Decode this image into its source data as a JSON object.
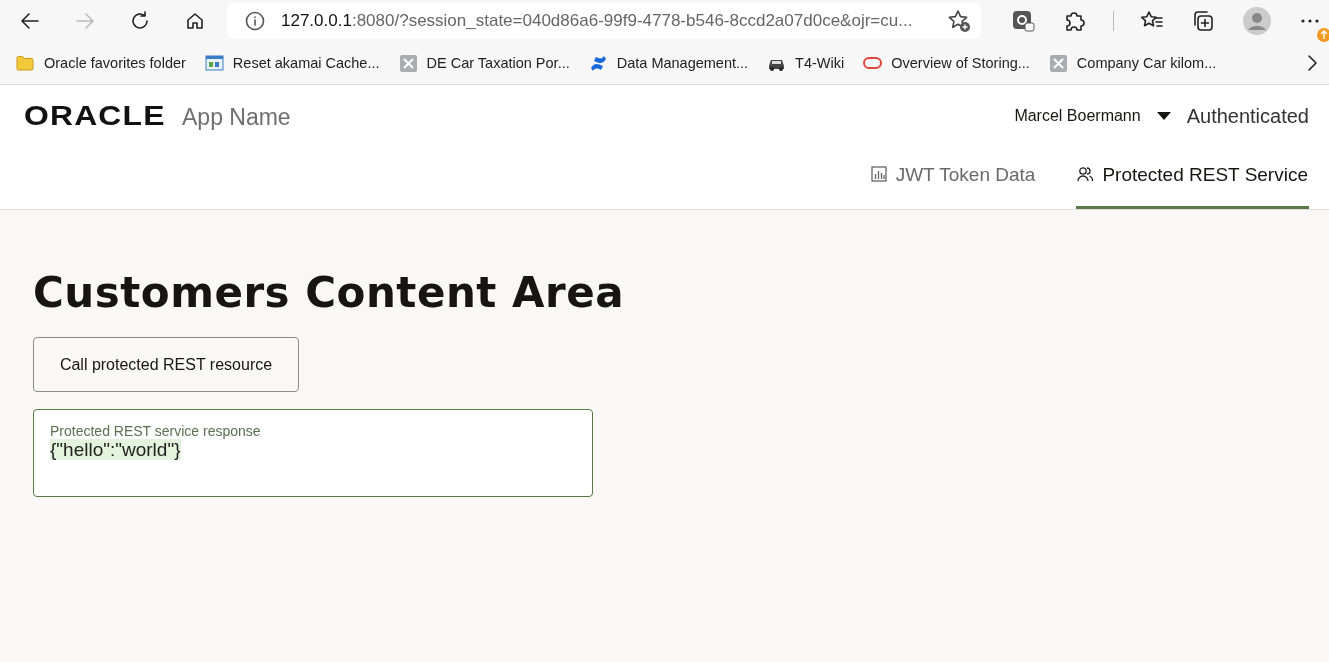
{
  "browser": {
    "back_enabled": true,
    "forward_enabled": false,
    "url": {
      "host": "127.0.0.1",
      "rest": ":8080/?session_state=040d86a6-99f9-4778-b546-8ccd2a07d0ce&ojr=cu..."
    },
    "update_badge": true
  },
  "bookmarks": [
    {
      "label": "Oracle favorites folder",
      "kind": "folder"
    },
    {
      "label": "Reset akamai Cache...",
      "kind": "webpage"
    },
    {
      "label": "DE Car Taxation Por...",
      "kind": "tile"
    },
    {
      "label": "Data Management...",
      "kind": "confluence"
    },
    {
      "label": "T4-Wiki",
      "kind": "car"
    },
    {
      "label": "Overview of Storing...",
      "kind": "oval"
    },
    {
      "label": "Company Car kilom...",
      "kind": "tile"
    }
  ],
  "app": {
    "logo": "ORACLE",
    "name": "App Name",
    "user": "Marcel Boermann",
    "status": "Authenticated"
  },
  "tabs": [
    {
      "label": "JWT Token Data",
      "kind": "chart",
      "selected": false
    },
    {
      "label": "Protected REST Service",
      "kind": "people",
      "selected": true
    }
  ],
  "content": {
    "title": "Customers Content Area",
    "button": "Call protected REST resource",
    "response": {
      "label": "Protected REST service response",
      "value": "{\"hello\":\"world\"}"
    }
  }
}
